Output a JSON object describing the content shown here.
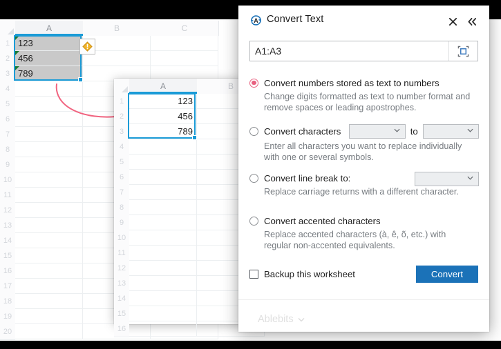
{
  "panel": {
    "title": "Convert Text",
    "title_icon": "convert-text-icon",
    "close_icon": "close-icon",
    "collapse_icon": "collapse-chevrons-icon",
    "range": {
      "value": "A1:A3",
      "placeholder": "",
      "picker_icon": "range-select-icon"
    },
    "options": [
      {
        "label": "Convert numbers stored as text to numbers",
        "description": "Change digits formatted as text to number format and remove spaces or leading apostrophes.",
        "selected": true
      },
      {
        "label": "Convert characters",
        "description": "Enter all characters you want to replace individually with one or several symbols.",
        "selected": false,
        "inline_to": "to",
        "combo_from_value": "",
        "combo_to_value": ""
      },
      {
        "label": "Convert line break to:",
        "description": "Replace carriage returns with a different character.",
        "selected": false,
        "combo_value": ""
      },
      {
        "label": "Convert accented characters",
        "description": "Replace accented characters (à, ê, õ, etc.) with regular non-accented equivalents.",
        "selected": false
      }
    ],
    "backup_checkbox": {
      "label": "Backup this worksheet",
      "checked": false
    },
    "convert_button": "Convert",
    "brand": "Ablebits",
    "brand_chevron": "chevron-down-icon",
    "accent_blue": "#1b72b8",
    "accent_radio": "#e8607f"
  },
  "sheet_before": {
    "columns": [
      "A",
      "B",
      "C"
    ],
    "rows": [
      "1",
      "2",
      "3",
      "4",
      "5",
      "6",
      "7",
      "8",
      "9",
      "10",
      "11",
      "12",
      "13",
      "14",
      "15",
      "16",
      "17",
      "18",
      "19",
      "20"
    ],
    "cells": [
      {
        "ref": "A1",
        "value": "123",
        "align": "left",
        "error_flag": true
      },
      {
        "ref": "A2",
        "value": "456",
        "align": "left",
        "error_flag": true
      },
      {
        "ref": "A3",
        "value": "789",
        "align": "left",
        "error_flag": true
      }
    ],
    "selection": "A1:A3",
    "warning_icon": "warning-diamond-icon"
  },
  "sheet_after": {
    "columns": [
      "A",
      "B"
    ],
    "rows": [
      "1",
      "2",
      "3",
      "4",
      "5",
      "6",
      "7",
      "8",
      "9",
      "10",
      "11",
      "12",
      "13",
      "14",
      "15",
      "16"
    ],
    "cells": [
      {
        "ref": "A1",
        "value": "123",
        "align": "right"
      },
      {
        "ref": "A2",
        "value": "456",
        "align": "right"
      },
      {
        "ref": "A3",
        "value": "789",
        "align": "right"
      }
    ],
    "selection": "A1:A3"
  },
  "arrow": {
    "name": "curved-transform-arrow",
    "color": "#f1637f"
  }
}
